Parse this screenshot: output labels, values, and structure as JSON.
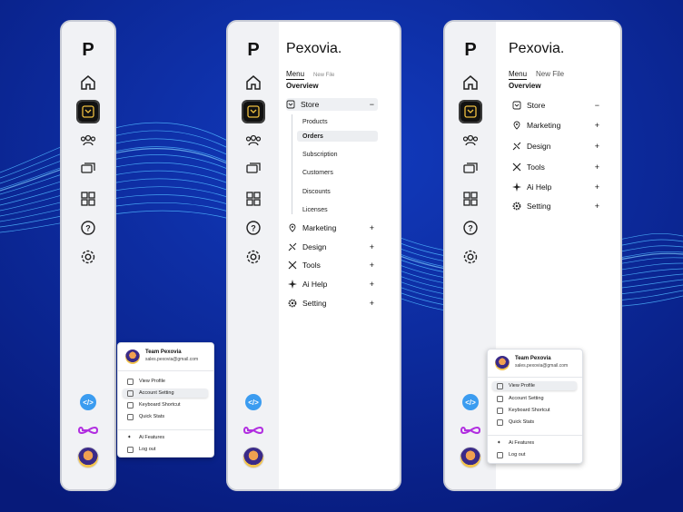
{
  "brand_letter": "P",
  "brand_name": "Pexovia.",
  "menu_tab": "Menu",
  "new_file_tab": "New File",
  "overview": "Overview",
  "menu": {
    "store": "Store",
    "marketing": "Marketing",
    "design": "Design",
    "tools": "Tools",
    "ai_help": "Ai Help",
    "setting": "Setting"
  },
  "store_sub": [
    "Products",
    "Orders",
    "Subscription",
    "Customers",
    "Discounts",
    "Licenses"
  ],
  "plus": "+",
  "minus": "−",
  "code_glyph": "</>",
  "profile": {
    "name": "Team Pexovia",
    "email": "sales.pexovia@gmail.com",
    "view_profile": "View Profile",
    "account_setting": "Account Setting",
    "keyboard_shortcut": "Keyboard Shortcut",
    "quick_stats": "Quick Stats",
    "ai_features": "Ai Features",
    "log_out": "Log out"
  },
  "colors": {
    "background": "#0a1f8f",
    "accent_blue": "#3b9cf0",
    "infinity": "#b12ee0"
  }
}
